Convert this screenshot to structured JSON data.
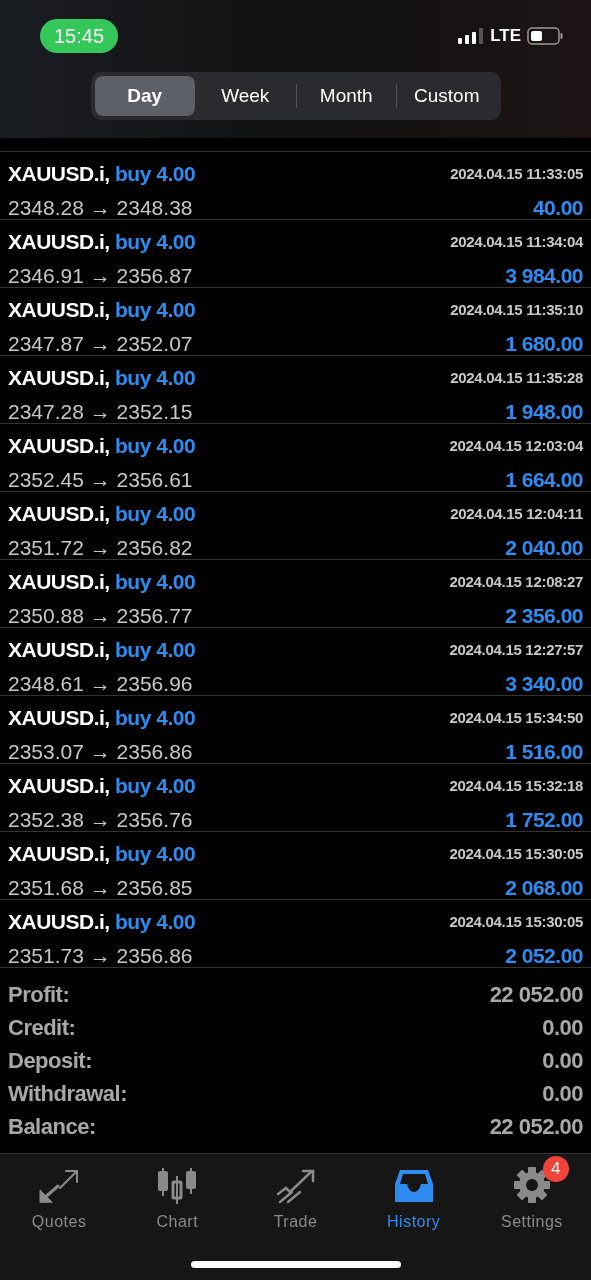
{
  "status_bar": {
    "time": "15:45",
    "network": "LTE"
  },
  "period_tabs": [
    {
      "label": "Day",
      "selected": true
    },
    {
      "label": "Week",
      "selected": false
    },
    {
      "label": "Month",
      "selected": false
    },
    {
      "label": "Custom",
      "selected": false
    }
  ],
  "deals": [
    {
      "symbol": "XAUUSD.i,",
      "side": "buy 4.00",
      "time": "2024.04.15 11:33:05",
      "prices": "2348.28 → 2348.38",
      "profit": "40.00"
    },
    {
      "symbol": "XAUUSD.i,",
      "side": "buy 4.00",
      "time": "2024.04.15 11:34:04",
      "prices": "2346.91 → 2356.87",
      "profit": "3 984.00"
    },
    {
      "symbol": "XAUUSD.i,",
      "side": "buy 4.00",
      "time": "2024.04.15 11:35:10",
      "prices": "2347.87 → 2352.07",
      "profit": "1 680.00"
    },
    {
      "symbol": "XAUUSD.i,",
      "side": "buy 4.00",
      "time": "2024.04.15 11:35:28",
      "prices": "2347.28 → 2352.15",
      "profit": "1 948.00"
    },
    {
      "symbol": "XAUUSD.i,",
      "side": "buy 4.00",
      "time": "2024.04.15 12:03:04",
      "prices": "2352.45 → 2356.61",
      "profit": "1 664.00"
    },
    {
      "symbol": "XAUUSD.i,",
      "side": "buy 4.00",
      "time": "2024.04.15 12:04:11",
      "prices": "2351.72 → 2356.82",
      "profit": "2 040.00"
    },
    {
      "symbol": "XAUUSD.i,",
      "side": "buy 4.00",
      "time": "2024.04.15 12:08:27",
      "prices": "2350.88 → 2356.77",
      "profit": "2 356.00"
    },
    {
      "symbol": "XAUUSD.i,",
      "side": "buy 4.00",
      "time": "2024.04.15 12:27:57",
      "prices": "2348.61 → 2356.96",
      "profit": "3 340.00"
    },
    {
      "symbol": "XAUUSD.i,",
      "side": "buy 4.00",
      "time": "2024.04.15 15:34:50",
      "prices": "2353.07 → 2356.86",
      "profit": "1 516.00"
    },
    {
      "symbol": "XAUUSD.i,",
      "side": "buy 4.00",
      "time": "2024.04.15 15:32:18",
      "prices": "2352.38 → 2356.76",
      "profit": "1 752.00"
    },
    {
      "symbol": "XAUUSD.i,",
      "side": "buy 4.00",
      "time": "2024.04.15 15:30:05",
      "prices": "2351.68 → 2356.85",
      "profit": "2 068.00"
    },
    {
      "symbol": "XAUUSD.i,",
      "side": "buy 4.00",
      "time": "2024.04.15 15:30:05",
      "prices": "2351.73 → 2356.86",
      "profit": "2 052.00"
    }
  ],
  "summary": [
    {
      "label": "Profit:",
      "value": "22 052.00"
    },
    {
      "label": "Credit:",
      "value": "0.00"
    },
    {
      "label": "Deposit:",
      "value": "0.00"
    },
    {
      "label": "Withdrawal:",
      "value": "0.00"
    },
    {
      "label": "Balance:",
      "value": "22 052.00"
    }
  ],
  "tab_bar": [
    {
      "kind": "quotes",
      "label": "Quotes",
      "selected": false
    },
    {
      "kind": "chart",
      "label": "Chart",
      "selected": false
    },
    {
      "kind": "trade",
      "label": "Trade",
      "selected": false
    },
    {
      "kind": "history",
      "label": "History",
      "selected": true
    },
    {
      "kind": "settings",
      "label": "Settings",
      "selected": false,
      "badge": "4"
    }
  ]
}
